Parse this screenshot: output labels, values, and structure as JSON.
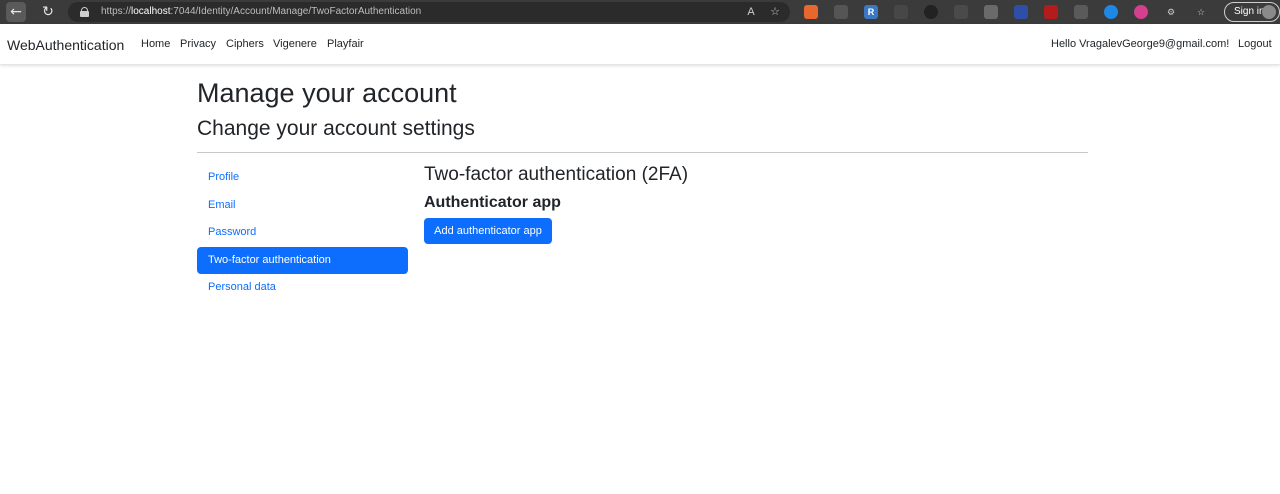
{
  "browser": {
    "url_prefix": "https://",
    "url_host": "localhost",
    "url_path": ":7044/Identity/Account/Manage/TwoFactorAuthentication",
    "signin_label": "Sign in",
    "icons": [
      "back-icon",
      "reload-icon",
      "lock-icon",
      "read-aloud-icon",
      "favorite-icon",
      "extension-icon",
      "settings-icon",
      "profile-icon"
    ]
  },
  "navbar": {
    "brand": "WebAuthentication",
    "links": [
      "Home",
      "Privacy",
      "Ciphers",
      "Vigenere",
      "Playfair"
    ],
    "greeting": "Hello VragalevGeorge9@gmail.com!",
    "logout": "Logout"
  },
  "page": {
    "title": "Manage your account",
    "subtitle": "Change your account settings"
  },
  "sidebar": {
    "items": [
      {
        "label": "Profile",
        "active": false
      },
      {
        "label": "Email",
        "active": false
      },
      {
        "label": "Password",
        "active": false
      },
      {
        "label": "Two-factor authentication",
        "active": true
      },
      {
        "label": "Personal data",
        "active": false
      }
    ]
  },
  "main": {
    "title": "Two-factor authentication (2FA)",
    "subtitle": "Authenticator app",
    "add_button": "Add authenticator app"
  },
  "colors": {
    "primary": "#0d6efd",
    "browser_bar": "#3b3b3b",
    "text": "#212529"
  }
}
